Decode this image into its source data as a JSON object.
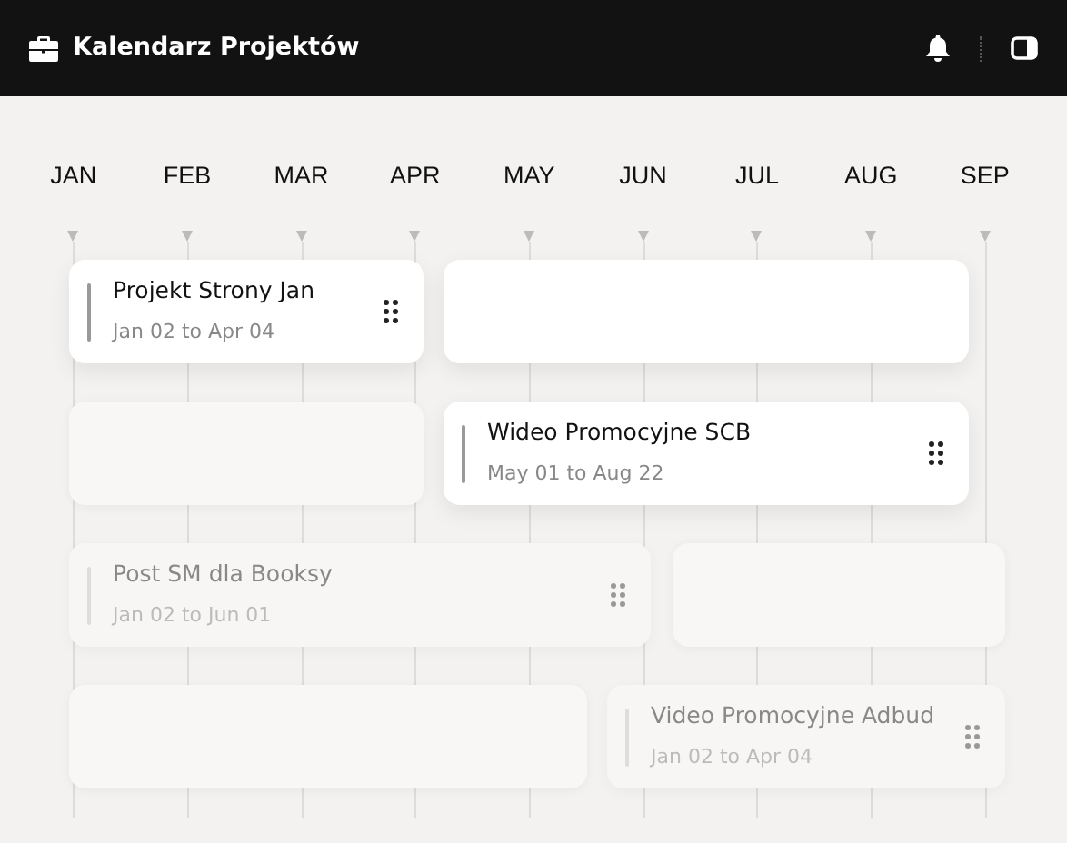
{
  "header": {
    "title": "Kalendarz Projektów"
  },
  "months": [
    "JAN",
    "FEB",
    "MAR",
    "APR",
    "MAY",
    "JUN",
    "JUL",
    "AUG",
    "SEP"
  ],
  "lanes": [
    {
      "items": [
        {
          "kind": "task",
          "title": "Projekt Strony Jan",
          "dates": "Jan 02 to Apr 04",
          "dimmed": false
        },
        {
          "kind": "empty"
        }
      ]
    },
    {
      "items": [
        {
          "kind": "faint"
        },
        {
          "kind": "task",
          "title": "Wideo Promocyjne SCB",
          "dates": "May 01 to Aug 22",
          "dimmed": false
        }
      ]
    },
    {
      "items": [
        {
          "kind": "task",
          "title": "Post SM dla Booksy",
          "dates": "Jan 02 to Jun 01",
          "dimmed": true
        },
        {
          "kind": "faint"
        }
      ]
    },
    {
      "items": [
        {
          "kind": "faint"
        },
        {
          "kind": "task",
          "title": "Video Promocyjne Adbud",
          "dates": "Jan 02 to Apr 04",
          "dimmed": true
        }
      ]
    }
  ]
}
